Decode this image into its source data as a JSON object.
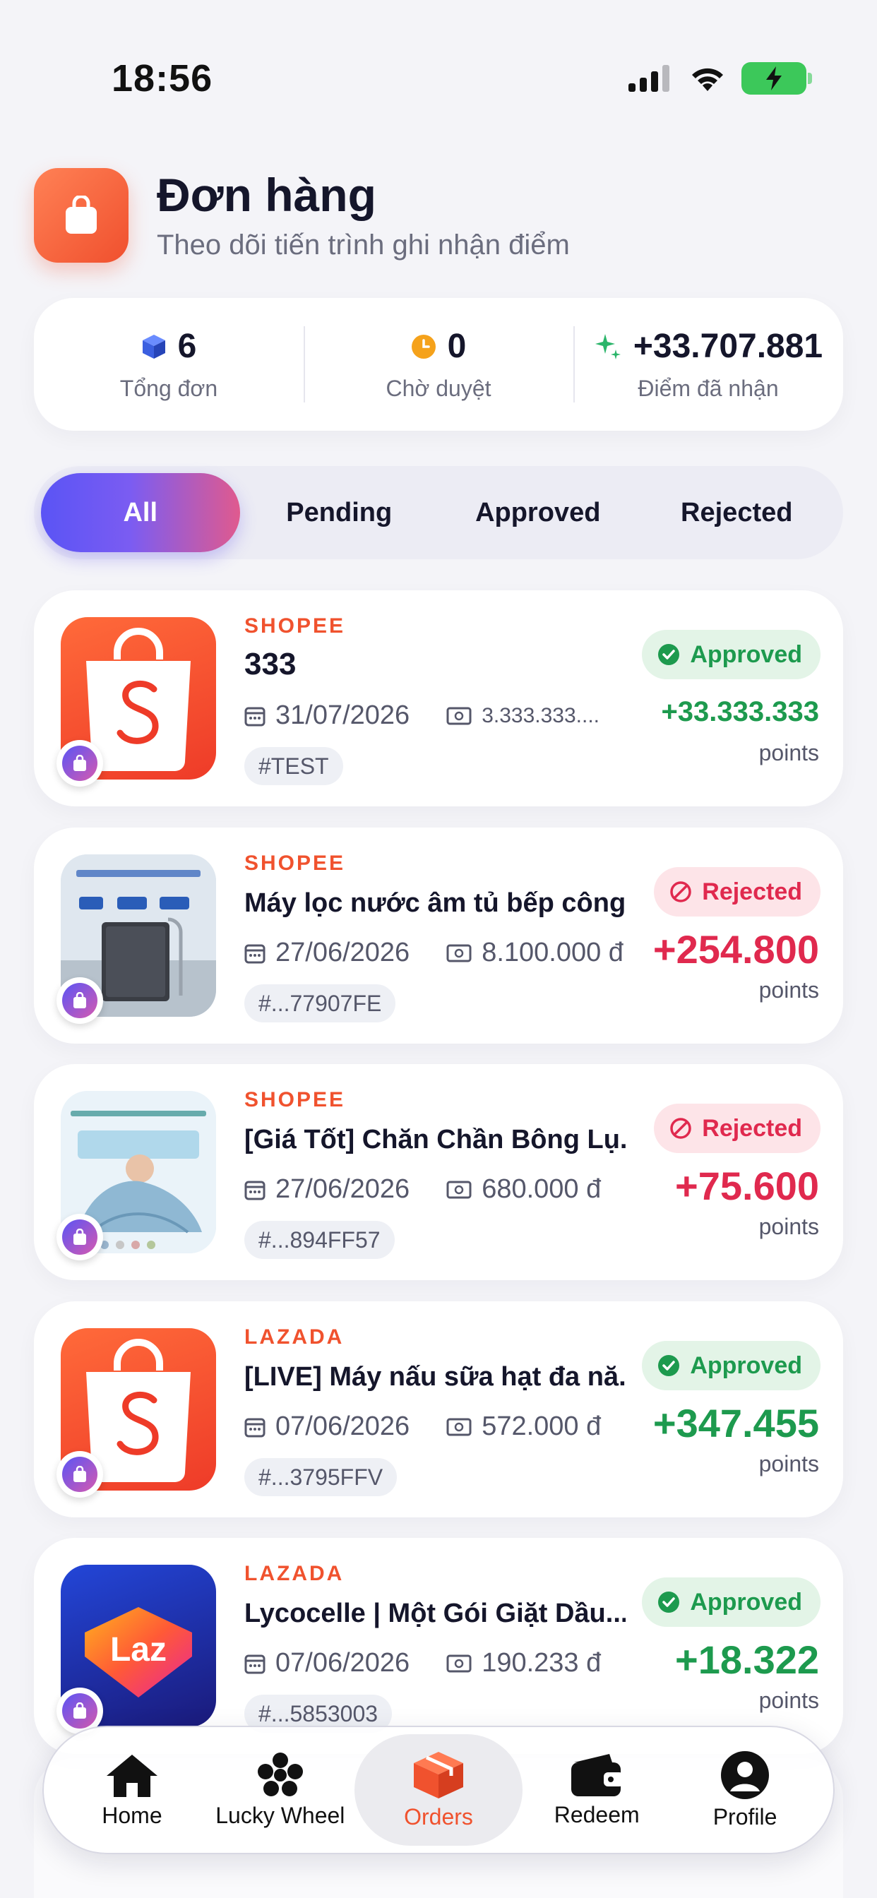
{
  "status_bar": {
    "time": "18:56"
  },
  "header": {
    "title": "Đơn hàng",
    "subtitle": "Theo dõi tiến trình ghi nhận điểm"
  },
  "stats": [
    {
      "value": "6",
      "label": "Tổng đơn",
      "icon": "cube-icon"
    },
    {
      "value": "0",
      "label": "Chờ duyệt",
      "icon": "clock-icon"
    },
    {
      "value": "+33.707.881",
      "label": "Điểm đã nhận",
      "icon": "sparkle-icon"
    }
  ],
  "tabs": [
    {
      "label": "All",
      "active": true
    },
    {
      "label": "Pending",
      "active": false
    },
    {
      "label": "Approved",
      "active": false
    },
    {
      "label": "Rejected",
      "active": false
    }
  ],
  "orders": [
    {
      "platform": "SHOPEE",
      "title": "333",
      "date": "31/07/2026",
      "amount": "3.333.333....",
      "tag": "#TEST",
      "status": "Approved",
      "points": "+33.333.333",
      "points_label": "points",
      "thumb": "shopee-logo"
    },
    {
      "platform": "SHOPEE",
      "title": "Máy lọc nước âm tủ bếp công...",
      "date": "27/06/2026",
      "amount": "8.100.000 đ",
      "tag": "#...77907FE",
      "status": "Rejected",
      "points": "+254.800",
      "points_label": "points",
      "thumb": "water-purifier-photo"
    },
    {
      "platform": "SHOPEE",
      "title": "[Giá Tốt] Chăn Chần Bông Lụ...",
      "date": "27/06/2026",
      "amount": "680.000 đ",
      "tag": "#...894FF57",
      "status": "Rejected",
      "points": "+75.600",
      "points_label": "points",
      "thumb": "silk-ice-blanket-photo"
    },
    {
      "platform": "LAZADA",
      "title": "[LIVE] Máy nấu sữa hạt đa nă...",
      "date": "07/06/2026",
      "amount": "572.000 đ",
      "tag": "#...3795FFV",
      "status": "Approved",
      "points": "+347.455",
      "points_label": "points",
      "thumb": "shopee-logo"
    },
    {
      "platform": "LAZADA",
      "title": "Lycocelle | Một Gói Giặt Dầu...",
      "date": "07/06/2026",
      "amount": "190.233 đ",
      "tag": "#...5853003",
      "status": "Approved",
      "points": "+18.322",
      "points_label": "points",
      "thumb": "lazada-logo"
    }
  ],
  "nav": [
    {
      "label": "Home",
      "icon": "home-icon"
    },
    {
      "label": "Lucky Wheel",
      "icon": "flower-icon"
    },
    {
      "label": "Orders",
      "icon": "box-icon",
      "active": true
    },
    {
      "label": "Redeem",
      "icon": "wallet-icon"
    },
    {
      "label": "Profile",
      "icon": "profile-icon"
    }
  ],
  "colors": {
    "accent": "#f0522e",
    "approved": "#1d9a4e",
    "rejected": "#e0294e",
    "tab_gradient_start": "#5a54f5",
    "tab_gradient_end": "#e05a8e"
  }
}
